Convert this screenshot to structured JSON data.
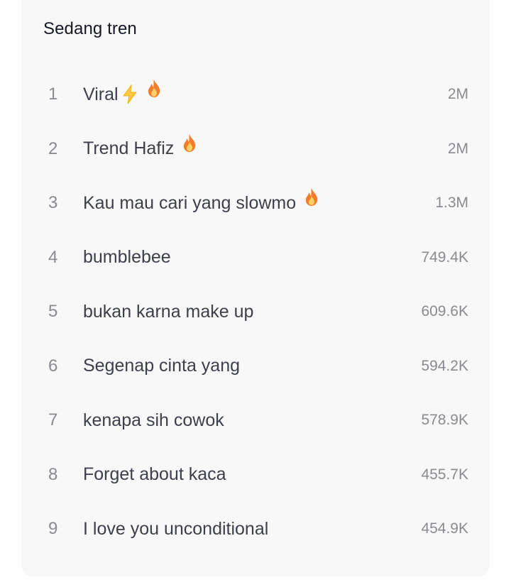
{
  "section": {
    "title": "Sedang tren"
  },
  "items": [
    {
      "rank": "1",
      "label": "Viral",
      "count": "2M",
      "badges": [
        "lightning-emoji",
        "fire-emoji"
      ]
    },
    {
      "rank": "2",
      "label": "Trend Hafiz",
      "count": "2M",
      "badges": [
        "fire-emoji"
      ]
    },
    {
      "rank": "3",
      "label": "Kau mau cari yang slowmo",
      "count": "1.3M",
      "badges": [
        "fire-emoji"
      ]
    },
    {
      "rank": "4",
      "label": "bumblebee",
      "count": "749.4K",
      "badges": []
    },
    {
      "rank": "5",
      "label": "bukan karna make up",
      "count": "609.6K",
      "badges": []
    },
    {
      "rank": "6",
      "label": "Segenap cinta yang",
      "count": "594.2K",
      "badges": []
    },
    {
      "rank": "7",
      "label": "kenapa sih cowok",
      "count": "578.9K",
      "badges": []
    },
    {
      "rank": "8",
      "label": "Forget about kaca",
      "count": "455.7K",
      "badges": []
    },
    {
      "rank": "9",
      "label": "I love you unconditional",
      "count": "454.9K",
      "badges": []
    }
  ],
  "colors": {
    "card_background": "#f8f8f8",
    "title_text": "#161823",
    "label_text": "#3d3f4a",
    "muted_text": "#8a8b91",
    "fire_outer": "#f57c2b",
    "fire_inner": "#ffd166",
    "lightning": "#ffc83d"
  }
}
